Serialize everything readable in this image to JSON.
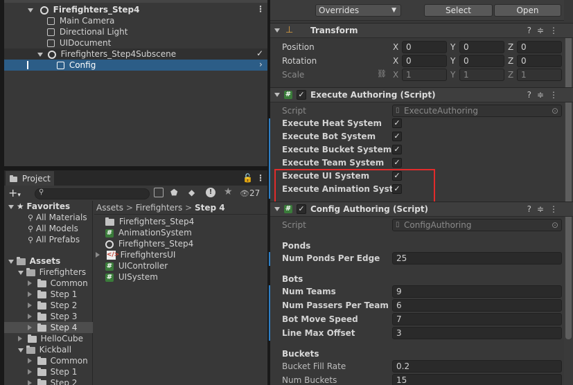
{
  "hierarchy": {
    "items": [
      {
        "label": "Firefighters_Step4",
        "bold": true
      },
      {
        "label": "Main Camera"
      },
      {
        "label": "Directional Light"
      },
      {
        "label": "UIDocument"
      },
      {
        "label": "Firefighters_Step4Subscene"
      },
      {
        "label": "Config"
      }
    ]
  },
  "project": {
    "tab_label": "Project",
    "hidden_count": "27",
    "breadcrumb": [
      "Assets",
      "Firefighters",
      "Step 4"
    ],
    "favorites_label": "Favorites",
    "favorites": [
      "All Materials",
      "All Models",
      "All Prefabs"
    ],
    "assets_label": "Assets",
    "tree": [
      "Firefighters",
      "Common",
      "Step 1",
      "Step 2",
      "Step 3",
      "Step 4",
      "HelloCube",
      "Kickball",
      "Common",
      "Step 1",
      "Step 2"
    ],
    "files": [
      "Firefighters_Step4",
      "AnimationSystem",
      "Firefighters_Step4",
      "FirefightersUI",
      "UIController",
      "UISystem"
    ]
  },
  "inspector": {
    "overrides_label": "Overrides",
    "select_label": "Select",
    "open_label": "Open",
    "transform": {
      "title": "Transform",
      "position_label": "Position",
      "rotation_label": "Rotation",
      "scale_label": "Scale",
      "x": "X",
      "y": "Y",
      "z": "Z",
      "position": [
        "0",
        "0",
        "0"
      ],
      "rotation": [
        "0",
        "0",
        "0"
      ],
      "scale": [
        "1",
        "1",
        "1"
      ]
    },
    "execute": {
      "title": "Execute Authoring (Script)",
      "script_label": "Script",
      "script_value": "ExecuteAuthoring",
      "toggles": [
        "Execute Heat System",
        "Execute Bot System",
        "Execute Bucket System",
        "Execute Team System",
        "Execute UI System",
        "Execute Animation Syst..."
      ]
    },
    "config": {
      "title": "Config Authoring (Script)",
      "script_label": "Script",
      "script_value": "ConfigAuthoring",
      "ponds_header": "Ponds",
      "num_ponds_label": "Num Ponds Per Edge",
      "num_ponds": "25",
      "bots_header": "Bots",
      "num_teams_label": "Num Teams",
      "num_teams": "9",
      "num_passers_label": "Num Passers Per Team",
      "num_passers": "6",
      "bot_speed_label": "Bot Move Speed",
      "bot_speed": "7",
      "line_offset_label": "Line Max Offset",
      "line_offset": "3",
      "buckets_header": "Buckets",
      "bucket_fill_label": "Bucket Fill Rate",
      "bucket_fill": "0.2",
      "num_buckets_label": "Num Buckets",
      "num_buckets": "15"
    }
  }
}
